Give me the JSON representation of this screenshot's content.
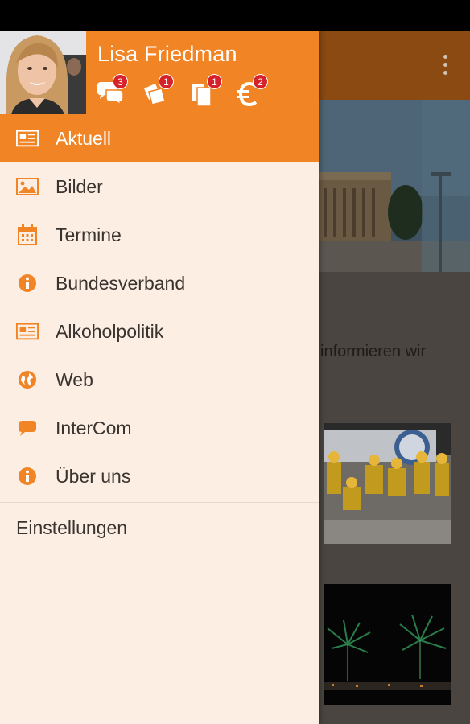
{
  "colors": {
    "accent": "#f18425",
    "drawer_bg": "#fdeee3",
    "badge": "#d6222a"
  },
  "user": {
    "name": "Lisa Friedman"
  },
  "header_icons": [
    {
      "icon": "chat-bubbles-icon",
      "badge": "3"
    },
    {
      "icon": "tickets-icon",
      "badge": "1"
    },
    {
      "icon": "documents-icon",
      "badge": "1"
    },
    {
      "icon": "euro-icon",
      "badge": "2"
    }
  ],
  "menu": {
    "items": [
      {
        "label": "Aktuell",
        "icon": "newspaper-icon",
        "active": true
      },
      {
        "label": "Bilder",
        "icon": "image-icon"
      },
      {
        "label": "Termine",
        "icon": "calendar-icon"
      },
      {
        "label": "Bundesverband",
        "icon": "info-icon"
      },
      {
        "label": "Alkoholpolitik",
        "icon": "newspaper-icon"
      },
      {
        "label": "Web",
        "icon": "globe-icon"
      },
      {
        "label": "InterCom",
        "icon": "chat-bubble-icon"
      },
      {
        "label": "Über uns",
        "icon": "info-icon"
      }
    ],
    "settings_label": "Einstellungen"
  },
  "background": {
    "snippet": "informieren wir"
  }
}
